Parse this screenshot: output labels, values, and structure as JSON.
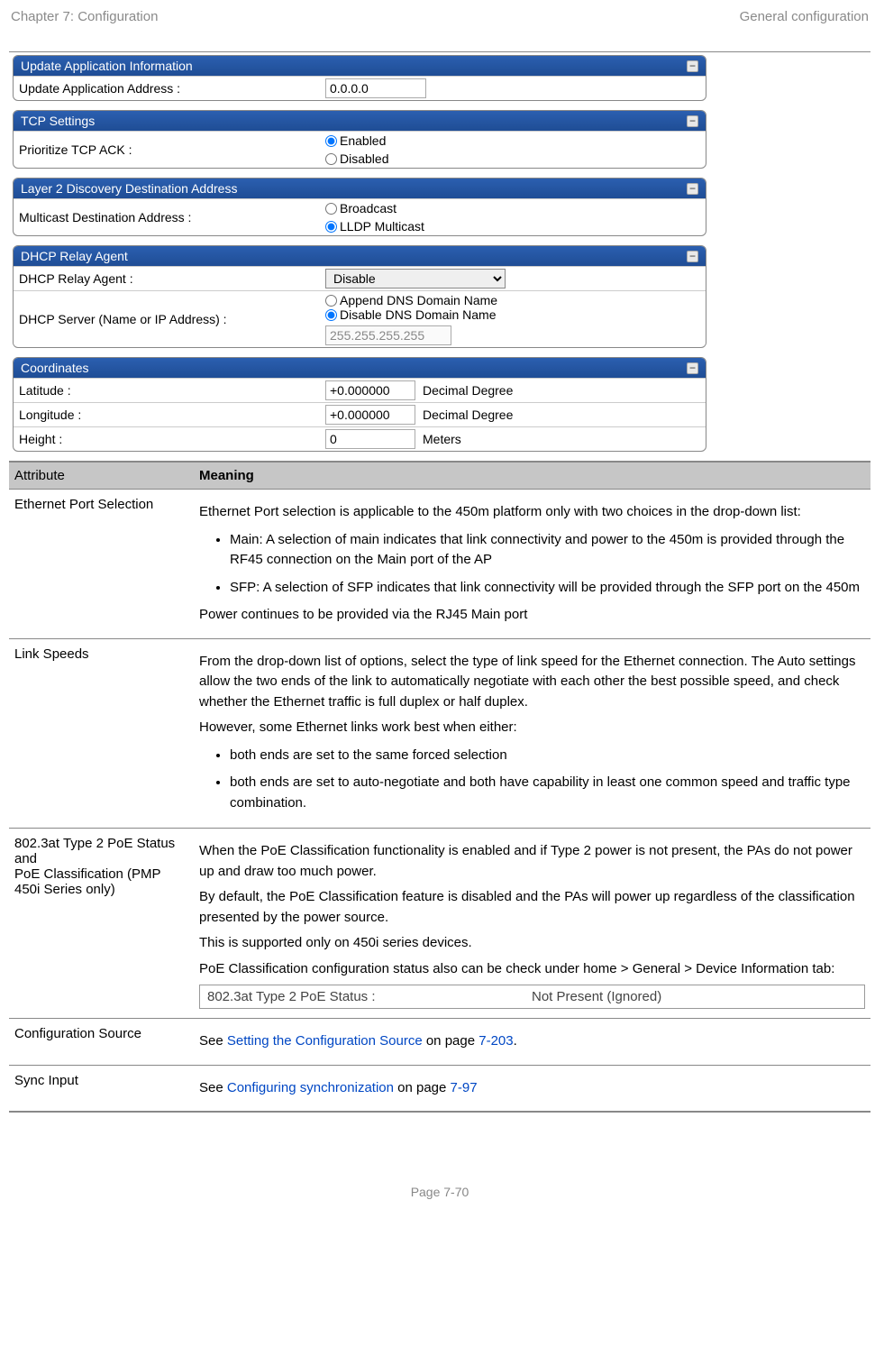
{
  "page_header": {
    "left": "Chapter 7:  Configuration",
    "right": "General configuration"
  },
  "panels": {
    "update_app": {
      "title": "Update Application Information",
      "label": "Update Application Address :",
      "value": "0.0.0.0"
    },
    "tcp": {
      "title": "TCP Settings",
      "label": "Prioritize TCP ACK :",
      "opt_enabled": "Enabled",
      "opt_disabled": "Disabled"
    },
    "layer2": {
      "title": "Layer 2 Discovery Destination Address",
      "label": "Multicast Destination Address :",
      "opt_broadcast": "Broadcast",
      "opt_lldp": "LLDP Multicast"
    },
    "dhcp": {
      "title": "DHCP Relay Agent",
      "agent_label": "DHCP Relay Agent :",
      "agent_value": "Disable",
      "server_label": "DHCP Server (Name or IP Address) :",
      "opt_append": "Append DNS Domain Name",
      "opt_disable": "Disable DNS Domain Name",
      "server_value": "255.255.255.255"
    },
    "coords": {
      "title": "Coordinates",
      "lat_label": "Latitude :",
      "lat_value": "+0.000000",
      "lat_unit": "Decimal Degree",
      "lon_label": "Longitude :",
      "lon_value": "+0.000000",
      "lon_unit": "Decimal Degree",
      "height_label": "Height :",
      "height_value": "0",
      "height_unit": "Meters"
    }
  },
  "table": {
    "head_attr": "Attribute",
    "head_mean": "Meaning",
    "rows": {
      "eth": {
        "attr": "Ethernet Port Selection",
        "p1": "Ethernet Port selection is applicable to the 450m platform only with two choices in the drop-down list:",
        "li1": "Main: A selection of main indicates that link connectivity and power to the 450m is provided through the RF45 connection on the Main port of the AP",
        "li2": "SFP: A selection of SFP indicates that link connectivity will be provided through the SFP port on the 450m",
        "p2": "Power continues to be provided via the RJ45 Main port"
      },
      "link": {
        "attr": "Link Speeds",
        "p1": "From the drop-down list of options, select the type of link speed for the Ethernet connection. The Auto settings allow the two ends of the link to automatically negotiate with each other the best possible speed, and check whether the Ethernet traffic is full duplex or half duplex.",
        "p2": " However, some Ethernet links work best when either:",
        "li1": "both ends are set to the same forced selection",
        "li2": "both ends are set to auto-negotiate and both have capability in least one common speed and traffic type combination."
      },
      "poe": {
        "attr1": "802.3at Type 2 PoE Status and",
        "attr2": "PoE Classification (PMP 450i Series only)",
        "p1": "When the PoE Classification functionality is enabled and if Type 2 power is not present, the PAs do not power up and draw too much power.",
        "p2": "By default, the PoE Classification feature is disabled and the PAs will power up regardless of the classification presented by the power source.",
        "p3": "This is supported only on 450i series devices.",
        "p4": "PoE Classification configuration status also can be check under home > General > Device Information tab:",
        "status_label": "802.3at Type 2 PoE Status :",
        "status_value": "Not Present (Ignored)"
      },
      "config_src": {
        "attr": "Configuration Source",
        "pre": "See ",
        "link": "Setting the Configuration Source",
        "mid": " on page ",
        "page": "7-203",
        "post": "."
      },
      "sync": {
        "attr": "Sync Input",
        "pre": "See ",
        "link": "Configuring synchronization",
        "mid": " on page ",
        "page": "7-97"
      }
    }
  },
  "footer": "Page 7-70"
}
